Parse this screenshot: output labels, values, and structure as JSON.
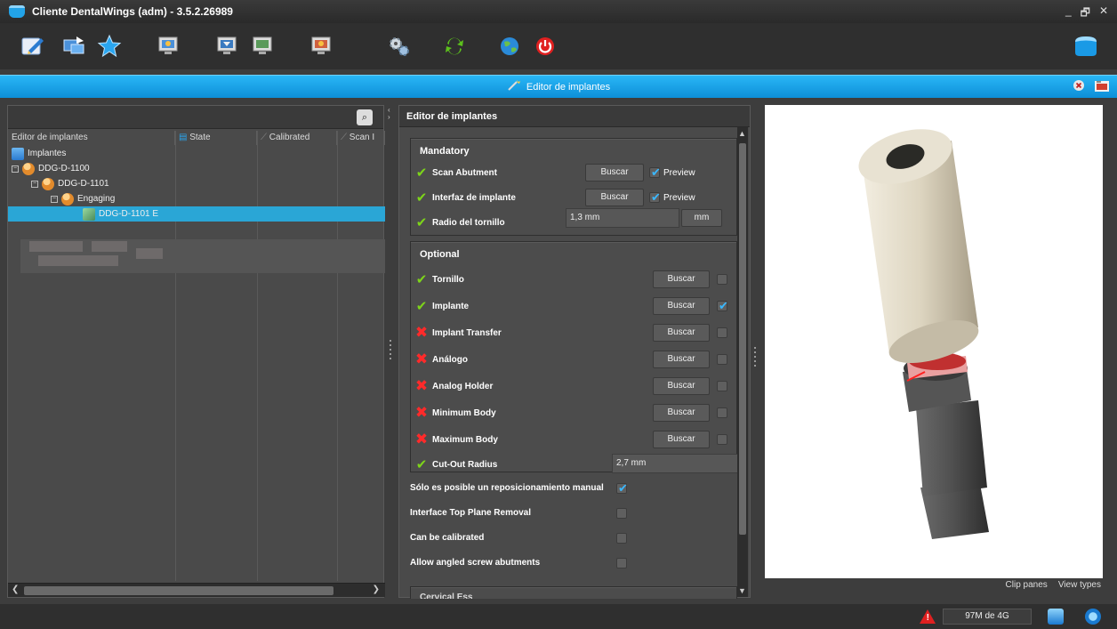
{
  "window": {
    "title": "Cliente DentalWings (adm) - 3.5.2.26989",
    "controls": [
      "_",
      "🗗",
      "✕"
    ]
  },
  "toolbar": {
    "icons": [
      "edit-icon",
      "computer-transfer-icon",
      "star-icon",
      "monitor-icon",
      "monitor2-icon",
      "monitor3-icon",
      "monitor4-icon",
      "gears-icon",
      "sync-icon",
      "globe-icon",
      "power-icon",
      "app-icon"
    ]
  },
  "header": {
    "title": "Editor de implantes"
  },
  "tree_panel": {
    "columns": [
      "Editor de implantes",
      "State",
      "Calibrated",
      "Scan I"
    ],
    "items": [
      {
        "label": "Implantes",
        "level": 0,
        "icon": "folder-icon"
      },
      {
        "label": "DDG-D-1100",
        "level": 1,
        "icon": "user-icon",
        "expander": "−"
      },
      {
        "label": "DDG-D-1101",
        "level": 2,
        "icon": "user-icon",
        "expander": "−"
      },
      {
        "label": "Engaging",
        "level": 3,
        "icon": "user-icon",
        "expander": "−"
      },
      {
        "label": "DDG-D-1101 E",
        "level": 4,
        "icon": "tool-icon",
        "selected": true
      }
    ]
  },
  "editor": {
    "title": "Editor de implantes",
    "mandatory": {
      "title": "Mandatory",
      "rows": [
        {
          "label": "Scan Abutment",
          "status": "ok",
          "button": "Buscar",
          "preview": "Preview",
          "preview_checked": true
        },
        {
          "label": "Interfaz de implante",
          "status": "ok",
          "button": "Buscar",
          "preview": "Preview",
          "preview_checked": true
        },
        {
          "label": "Radio del tornillo",
          "status": "ok",
          "value": "1,3 mm",
          "unit": "mm"
        }
      ]
    },
    "optional": {
      "title": "Optional",
      "rows": [
        {
          "label": "Tornillo",
          "status": "ok",
          "button": "Buscar",
          "checked": false
        },
        {
          "label": "Implante",
          "status": "ok",
          "button": "Buscar",
          "checked": true
        },
        {
          "label": "Implant Transfer",
          "status": "bad",
          "button": "Buscar",
          "checked": false
        },
        {
          "label": "Análogo",
          "status": "bad",
          "button": "Buscar",
          "checked": false
        },
        {
          "label": "Analog Holder",
          "status": "bad",
          "button": "Buscar",
          "checked": false
        },
        {
          "label": "Minimum Body",
          "status": "bad",
          "button": "Buscar",
          "checked": false
        },
        {
          "label": "Maximum Body",
          "status": "bad",
          "button": "Buscar",
          "checked": false
        },
        {
          "label": "Cut-Out Radius",
          "status": "ok",
          "value": "2,7 mm"
        }
      ]
    },
    "options": [
      {
        "label": "Sólo es posible un reposicionamiento manual",
        "checked": true
      },
      {
        "label": "Interface Top Plane Removal",
        "checked": false
      },
      {
        "label": "Can be calibrated",
        "checked": false
      },
      {
        "label": "Allow angled screw abutments",
        "checked": false
      }
    ],
    "next_section": "Cervical Ess"
  },
  "viewport": {
    "links": [
      "Clip panes",
      "View types"
    ]
  },
  "status": {
    "memory": "97M de 4G"
  }
}
